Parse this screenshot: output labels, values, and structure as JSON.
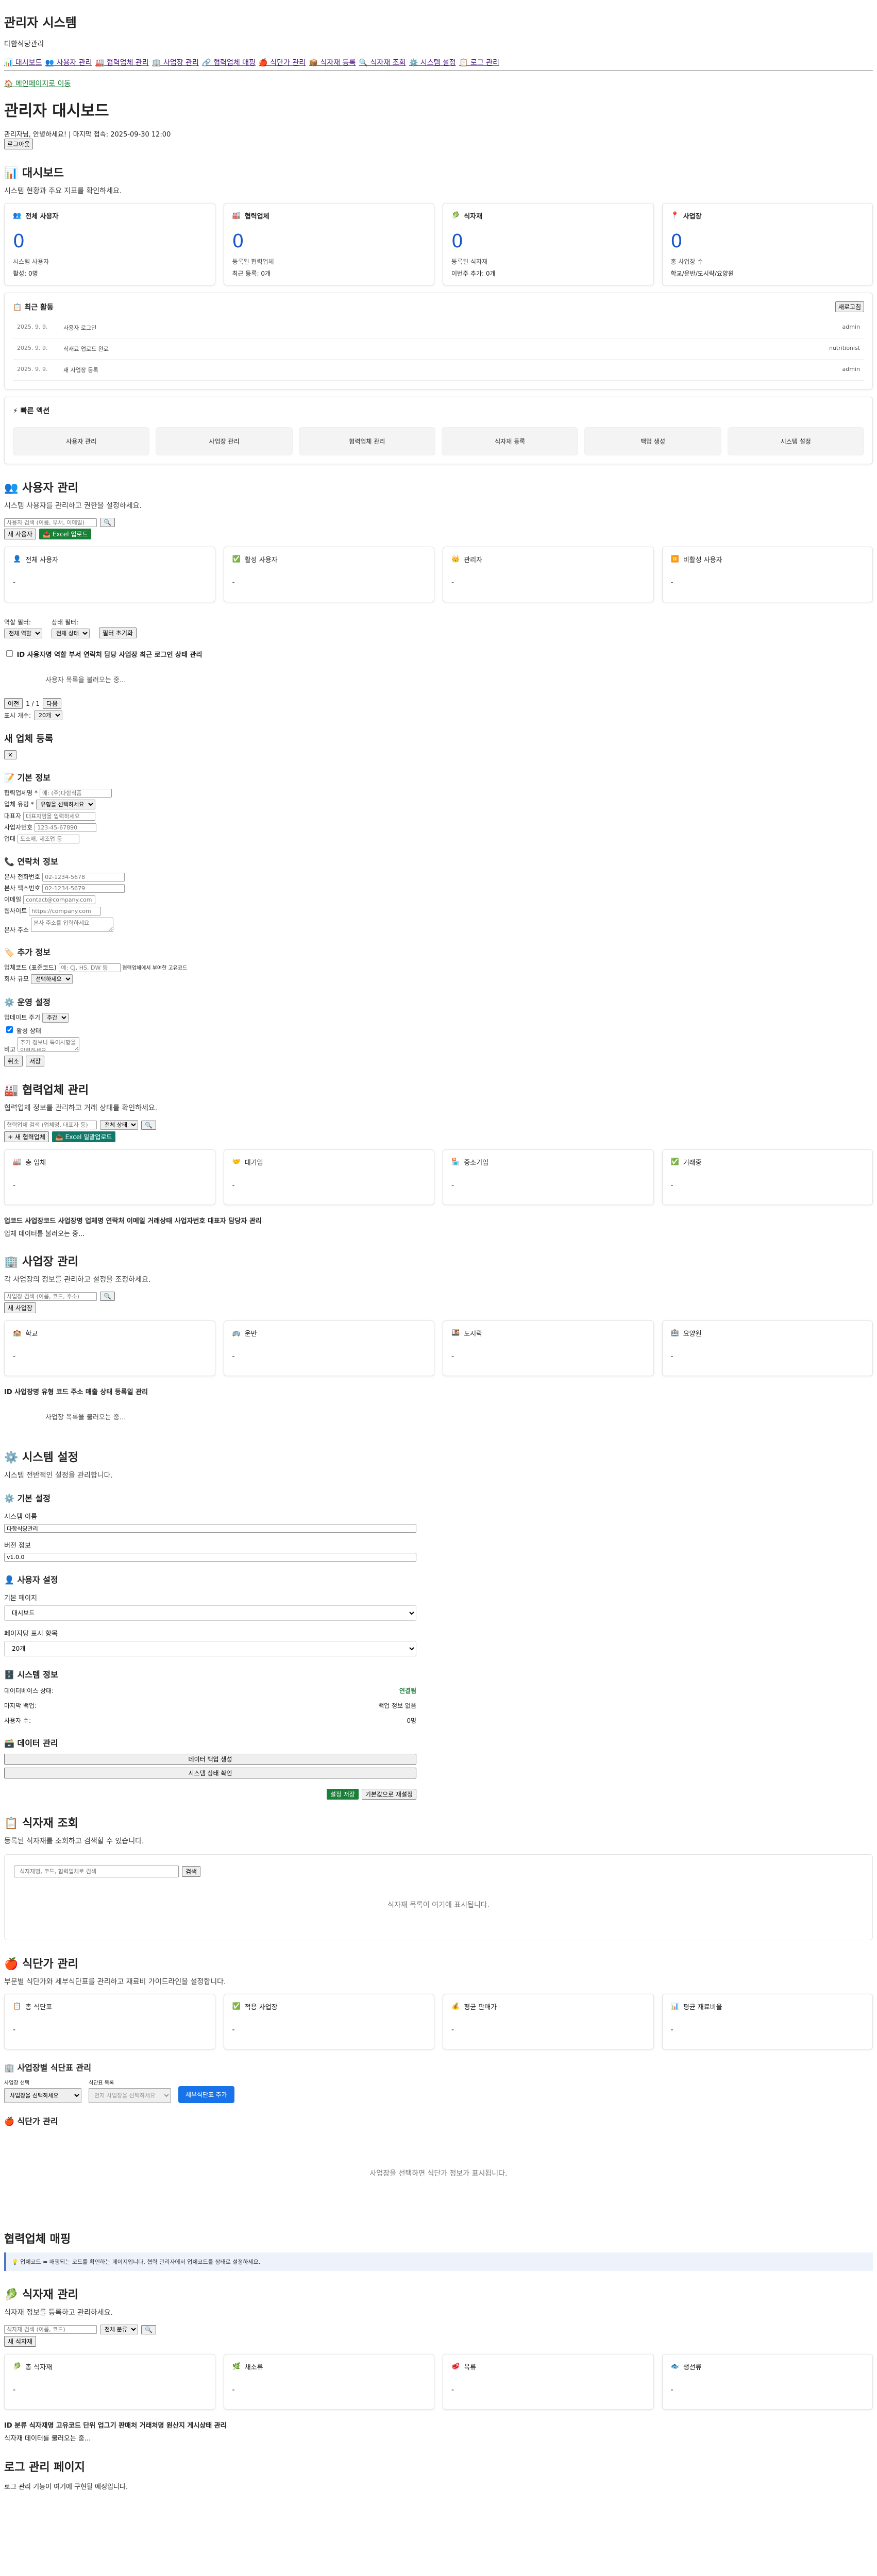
{
  "header": {
    "site_title": "관리자 시스템",
    "subtitle": "다함식당관리"
  },
  "nav": {
    "items": [
      "📊 대시보드",
      "👥 사용자 관리",
      "🏭 협력업체 관리",
      "🏢 사업장 관리",
      "🔗 협력업체 매핑",
      "🍎 식단가 관리",
      "📦 식자재 등록",
      "🔍 식자재 조회",
      "⚙️ 시스템 설정",
      "📋 로그 관리"
    ],
    "back": "🏠 메인페이지로 이동"
  },
  "dashboard": {
    "title": "관리자 대시보드",
    "welcome": "관리자님, 안녕하세요! | 마지막 접속: 2025-09-30 12:00",
    "logout": "로그아웃",
    "section": "📊 대시보드",
    "desc": "시스템 현황과 주요 지표를 확인하세요.",
    "cards": [
      {
        "icon": "👥",
        "title": "전체 사용자",
        "num": "0",
        "sub": "시스템 사용자",
        "val": "활성: 0명"
      },
      {
        "icon": "🏭",
        "title": "협력업체",
        "num": "0",
        "sub": "등록된 협력업체",
        "val": "최근 등록: 0개"
      },
      {
        "icon": "🥬",
        "title": "식자재",
        "num": "0",
        "sub": "등록된 식자재",
        "val": "이번주 추가: 0개"
      },
      {
        "icon": "📍",
        "title": "사업장",
        "num": "0",
        "sub": "총 사업장 수",
        "val": "학교/운반/도시락/요양원"
      }
    ],
    "recent": {
      "title": "최근 활동",
      "refresh": "새로고침",
      "items": [
        {
          "time": "2025. 9. 9.",
          "action": "사용자 로그인",
          "user": "admin"
        },
        {
          "time": "2025. 9. 9.",
          "action": "식재료 업로드 완료",
          "user": "nutritionist"
        },
        {
          "time": "2025. 9. 9.",
          "action": "새 사업장 등록",
          "user": "admin"
        }
      ]
    },
    "quick": {
      "title": "빠른 액션",
      "items": [
        "사용자 관리",
        "사업장 관리",
        "협력업체 관리",
        "식자재 등록",
        "백업 생성",
        "시스템 설정"
      ]
    }
  },
  "users": {
    "title": "👥 사용자 관리",
    "desc": "시스템 사용자를 관리하고 권한을 설정하세요.",
    "search_placeholder": "사용자 검색 (이름, 부서, 이메일)",
    "add": "새 사용자",
    "excel": "📥 Excel 업로드",
    "stats": [
      {
        "icon": "👤",
        "label": "전체 사용자",
        "val": "-"
      },
      {
        "icon": "✅",
        "label": "활성 사용자",
        "val": "-"
      },
      {
        "icon": "👑",
        "label": "관리자",
        "val": "-"
      },
      {
        "icon": "⏸️",
        "label": "비활성 사용자",
        "val": "-"
      }
    ],
    "filter_role_label": "역할 필터:",
    "filter_role": "전체 역할",
    "filter_status_label": "상태 필터:",
    "filter_status": "전체 상태",
    "filter_reset": "필터 초기화",
    "columns": "ID 사용자명 역할 부서 연락처 담당 사업장 최근 로그인 상태 관리",
    "loading": "사용자 목록을 불러오는 중...",
    "prev": "이전",
    "page": "1 / 1",
    "next": "다음",
    "per_page_label": "표시 개수:",
    "per_page": "20개"
  },
  "new_user": {
    "title": "새 업체 등록",
    "close": "×",
    "basic_title": "📝 기본 정보",
    "fields": [
      {
        "label": "협력업체명 *",
        "ph": "예: (주)다함식품"
      },
      {
        "label": "업체 유형 *",
        "select": "유형을 선택하세요"
      },
      {
        "label": "대표자",
        "ph": "대표자명을 입력하세요"
      },
      {
        "label": "사업자번호",
        "ph": "123-45-67890"
      },
      {
        "label": "업태",
        "ph": "도소매, 제조업 등"
      }
    ],
    "contact_title": "📞 연락처 정보",
    "contacts": [
      {
        "label": "본사 전화번호",
        "ph": "02-1234-5678"
      },
      {
        "label": "본사 팩스번호",
        "ph": "02-1234-5679"
      },
      {
        "label": "이메일",
        "ph": "contact@company.com"
      },
      {
        "label": "웹사이트",
        "ph": "https://company.com"
      }
    ],
    "address_label": "본사 주소",
    "address_ph": "본사 주소를 입력하세요",
    "extra_title": "🏷️ 추가 정보",
    "short_code_label": "업체코드 (표준코드)",
    "short_code_ph": "예: CJ, HS, DW 등",
    "short_code_note": "협력업체에서 부여한 고유코드",
    "biz_size_label": "회사 규모",
    "biz_size": "선택하세요",
    "ops_title": "⚙️ 운영 설정",
    "cycle_label": "업데이트 주기",
    "cycle": "주간",
    "active_label": "활성 상태",
    "notes_label": "비고",
    "notes_ph": "추가 정보나 특이사항을 입력하세요",
    "cancel": "취소",
    "save": "저장"
  },
  "suppliers": {
    "title": "🏭 협력업체 관리",
    "desc": "협력업체 정보를 관리하고 거래 상태를 확인하세요.",
    "search_placeholder": "협력업체 검색 (업체명, 대표자 등)",
    "filter": "전체 상태",
    "add": "+ 새 협력업체",
    "excel": "📥 Excel 일괄업로드",
    "stats": [
      {
        "icon": "🏭",
        "label": "총 업체",
        "val": "-"
      },
      {
        "icon": "🤝",
        "label": "대기업",
        "val": "-"
      },
      {
        "icon": "🏪",
        "label": "중소기업",
        "val": "-"
      },
      {
        "icon": "✅",
        "label": "거래중",
        "val": "-"
      }
    ],
    "columns": "업코드 사업장코드 사업장명 업체명 연락처 이메일 거래상태 사업자번호 대표자 담당자 관리",
    "loading": "업체 데이터를 불러오는 중..."
  },
  "sites": {
    "title": "🏢 사업장 관리",
    "desc": "각 사업장의 정보를 관리하고 설정을 조정하세요.",
    "search_placeholder": "사업장 검색 (이름, 코드, 주소)",
    "add": "새 사업장",
    "stats": [
      {
        "icon": "🏫",
        "label": "학교",
        "val": "-"
      },
      {
        "icon": "🚌",
        "label": "운반",
        "val": "-"
      },
      {
        "icon": "🍱",
        "label": "도시락",
        "val": "-"
      },
      {
        "icon": "🏥",
        "label": "요양원",
        "val": "-"
      }
    ],
    "columns": "ID 사업장명 유형 코드 주소 매출 상태 등록일 관리",
    "loading": "사업장 목록을 불러오는 중..."
  },
  "settings": {
    "title": "⚙️ 시스템 설정",
    "desc": "시스템 전반적인 설정을 관리합니다.",
    "basic_title": "⚙️ 기본 설정",
    "sys_name_label": "시스템 이름",
    "sys_name": "다함식당관리",
    "version_label": "버전 정보",
    "version": "v1.0.0",
    "user_title": "👤 사용자 설정",
    "default_page_label": "기본 페이지",
    "default_page": "대시보드",
    "page_count_label": "페이지당 표시 항목",
    "page_count": "20개",
    "info_title": "🗄️ 시스템 정보",
    "db_label": "데이터베이스 상태:",
    "db_val": "연결됨",
    "backup_label": "마지막 백업:",
    "backup_val": "백업 정보 없음",
    "user_count_label": "사용자 수:",
    "user_count_val": "0명",
    "data_title": "🗃️ 데이터 관리",
    "backup_btn": "데이터 백업 생성",
    "check_btn": "시스템 상태 확인",
    "save_btn": "설정 저장",
    "reset_btn": "기본값으로 재설정"
  },
  "ingredient_search": {
    "title": "📋 식자재 조회",
    "desc": "등록된 식자재를 조회하고 검색할 수 있습니다.",
    "search_placeholder": "식자재명, 코드, 협력업체로 검색",
    "search_btn": "검색",
    "empty": "식자재 목록이 여기에 표시됩니다."
  },
  "meal_price": {
    "title": "🍎 식단가 관리",
    "desc": "부문별 식단가와 세부식단표를 관리하고 재료비 가이드라인을 설정합니다.",
    "stats": [
      {
        "icon": "📋",
        "label": "총 식단표",
        "val": "-"
      },
      {
        "icon": "✅",
        "label": "적용 사업장",
        "val": "-"
      },
      {
        "icon": "💰",
        "label": "평균 판매가",
        "val": "-"
      },
      {
        "icon": "📊",
        "label": "평균 재료비율",
        "val": "-"
      }
    ],
    "site_title": "🏢 사업장별 식단표 관리",
    "site_label": "사업장 선택",
    "site_select": "사업장을 선택하세요",
    "plan_label": "식단표 목록",
    "plan_select": "먼저 사업장을 선택하세요",
    "new_plan": "세부식단표 추가",
    "price_title": "🍎 식단가 관리",
    "empty": "사업장을 선택하면 식단가 정보가 표시됩니다."
  },
  "mapping": {
    "title": "협력업체 매핑",
    "info": "💡 업체코드 = 매핑되는 코드를 확인하는 페이지입니다. 협력 관리자에서 업체코드를 상태로 설정하세요."
  },
  "ingredients": {
    "title": "🥬 식자재 관리",
    "desc": "식자재 정보를 등록하고 관리하세요.",
    "search_placeholder": "식자재 검색 (이름, 코드)",
    "filter": "전체 분류",
    "add": "새 식자재",
    "stats": [
      {
        "icon": "🥬",
        "label": "총 식자재",
        "val": "-"
      },
      {
        "icon": "🌿",
        "label": "채소류",
        "val": "-"
      },
      {
        "icon": "🥩",
        "label": "육류",
        "val": "-"
      },
      {
        "icon": "🐟",
        "label": "생선류",
        "val": "-"
      }
    ],
    "columns": "ID 분류 식자재명 고유코드 단위 업그기 판매처 거래처명 원산지 게시상태 관리",
    "loading": "식자재 데이터를 불러오는 중..."
  },
  "logs": {
    "title": "로그 관리 페이지",
    "desc": "로그 관리 기능이 여기에 구현될 예정입니다."
  }
}
